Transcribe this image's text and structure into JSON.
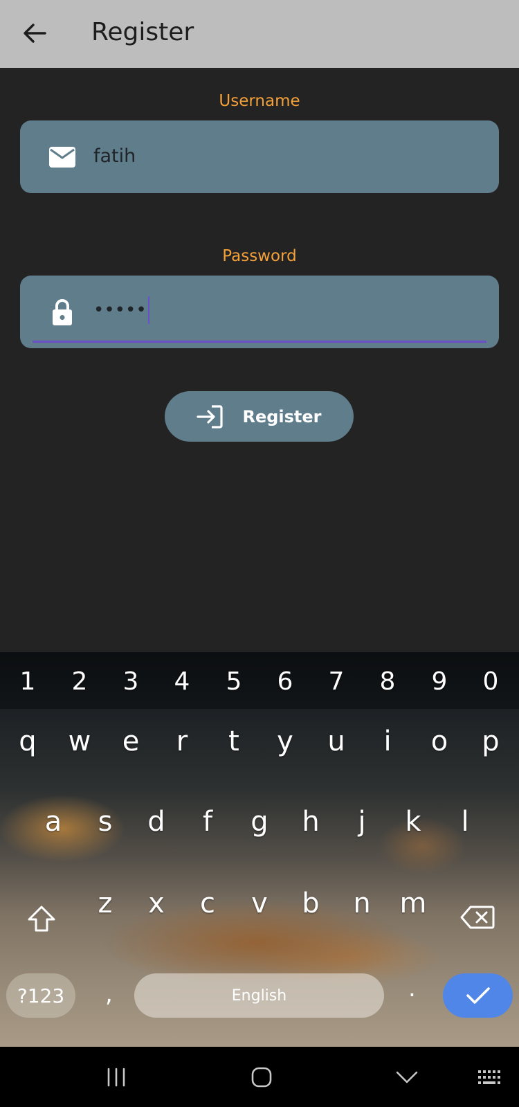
{
  "appbar": {
    "title": "Register",
    "back_icon": "arrow-left-icon"
  },
  "form": {
    "username": {
      "label": "Username",
      "value": "fatih",
      "icon": "mail-icon"
    },
    "password": {
      "label": "Password",
      "value": "•••••",
      "icon": "lock-icon",
      "focused": true
    },
    "register_button": {
      "label": "Register",
      "icon": "login-icon"
    }
  },
  "keyboard": {
    "number_row": [
      "1",
      "2",
      "3",
      "4",
      "5",
      "6",
      "7",
      "8",
      "9",
      "0"
    ],
    "row1": [
      "q",
      "w",
      "e",
      "r",
      "t",
      "y",
      "u",
      "i",
      "o",
      "p"
    ],
    "row2": [
      "a",
      "s",
      "d",
      "f",
      "g",
      "h",
      "j",
      "k",
      "l"
    ],
    "row3": [
      "z",
      "x",
      "c",
      "v",
      "b",
      "n",
      "m"
    ],
    "symbols_key": "?123",
    "comma_key": ",",
    "space_key": "English",
    "period_key": ".",
    "shift_icon": "shift-icon",
    "backspace_icon": "backspace-icon",
    "done_icon": "check-icon"
  },
  "navbar": {
    "recents_icon": "recents-icon",
    "home_icon": "home-icon",
    "back_icon": "hide-keyboard-icon",
    "keyboard_icon": "keyboard-icon"
  },
  "colors": {
    "appbar_bg": "#bdbdbd",
    "page_bg": "#232323",
    "label_accent": "#f2a13a",
    "field_bg": "#607d8b",
    "focus_underline": "#6a4fc8",
    "done_key": "#4f86e8"
  }
}
